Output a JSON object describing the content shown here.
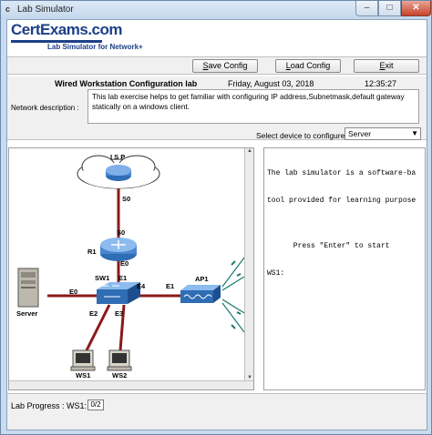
{
  "window": {
    "title": "Lab Simulator",
    "icon": "c"
  },
  "logo": {
    "main": "CertExams.com",
    "sub": "Lab Simulator for Network+"
  },
  "toolbar": {
    "save_label": "ave Config",
    "save_key": "S",
    "load_label": "oad Config",
    "load_key": "L",
    "exit_label": "xit",
    "exit_key": "E"
  },
  "lab": {
    "title": "Wired Workstation Configuration lab",
    "date": "Friday, August 03, 2018",
    "time": "12:35:27",
    "description_label": "Network description :",
    "description": "This lab exercise helps to get familiar with configuring IP address,Subnetmask,default gateway statically on a windows client."
  },
  "device_select": {
    "label": "Select device to configure :",
    "value": "Server"
  },
  "diagram": {
    "nodes": {
      "isp": "I S P",
      "r1": "R1",
      "sw1": "SW1",
      "ap1": "AP1",
      "server": "Server",
      "ws1": "WS1",
      "ws2": "WS2"
    },
    "ports": {
      "isp_s0": "S0",
      "r1_s0": "S0",
      "r1_e0": "E0",
      "sw1_e1": "E1",
      "sw1_e0": "E0",
      "sw1_e4": "E4",
      "sw1_e2": "E2",
      "sw1_e3": "E3",
      "ap1_e1": "E1"
    }
  },
  "console": {
    "lines": [
      "The lab simulator is a software-ba",
      "tool provided for learning purpose",
      "",
      "      Press \"Enter\" to start",
      "WS1:"
    ]
  },
  "progress": {
    "label": "Lab Progress :  WS1:",
    "value": "0/2"
  },
  "colors": {
    "link": "#8b1a1a",
    "router": "#2f6db5",
    "switch": "#2f6db5",
    "wireless": "#1a7a6a",
    "logo": "#1c3f86"
  }
}
